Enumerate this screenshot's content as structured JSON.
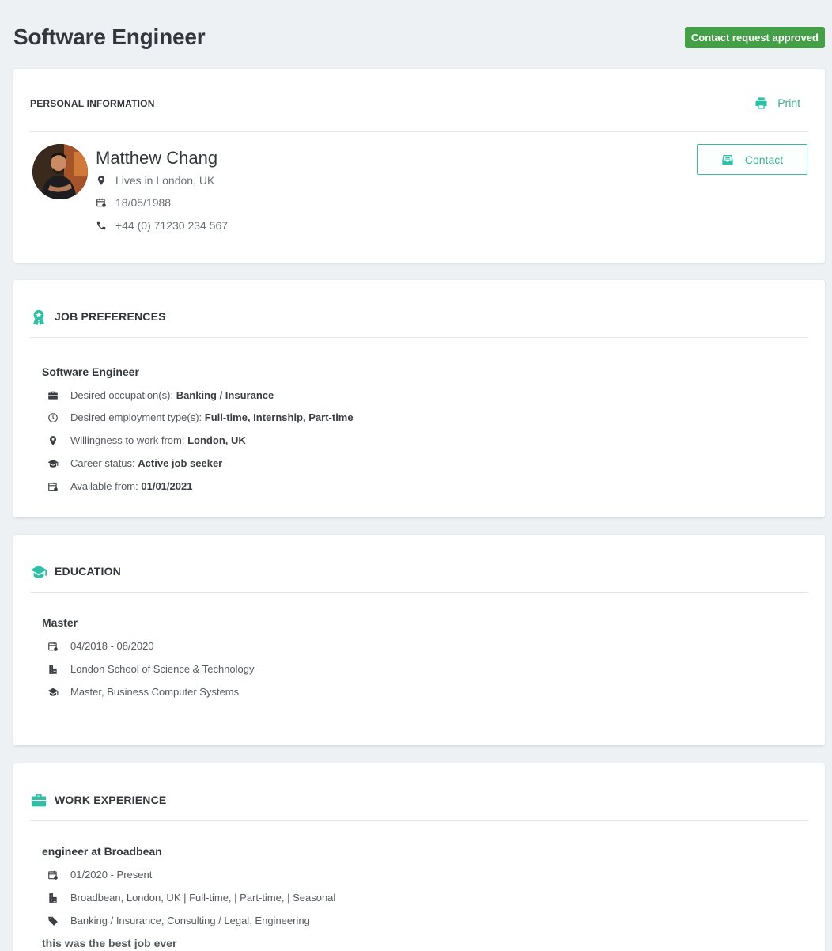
{
  "header": {
    "title": "Software Engineer",
    "status_badge": "Contact request approved",
    "status_color": "#43a047"
  },
  "personal": {
    "section_title": "Personal Information",
    "print_label": "Print",
    "name": "Matthew Chang",
    "location": "Lives in London, UK",
    "birthdate": "18/05/1988",
    "phone": "+44 (0) 71230 234 567",
    "contact_label": "Contact"
  },
  "job_preferences": {
    "section_title": "Job Preferences",
    "job_title": "Software Engineer",
    "rows": [
      {
        "label": "Desired occupation(s): ",
        "value": "Banking / Insurance",
        "icon": "briefcase-icon"
      },
      {
        "label": "Desired employment type(s): ",
        "value": "Full-time, Internship, Part-time",
        "icon": "clock-icon"
      },
      {
        "label": "Willingness to work from: ",
        "value": "London, UK",
        "icon": "location-pin-icon"
      },
      {
        "label": "Career status: ",
        "value": "Active job seeker",
        "icon": "graduation-cap-icon"
      },
      {
        "label": "Available from: ",
        "value": "01/01/2021",
        "icon": "calendar-icon"
      }
    ]
  },
  "education": {
    "section_title": "Education",
    "degree": "Master",
    "rows": [
      {
        "text": "04/2018 - 08/2020",
        "icon": "calendar-icon"
      },
      {
        "text": "London School of Science & Technology",
        "icon": "building-icon"
      },
      {
        "text": "Master, Business Computer Systems",
        "icon": "graduation-cap-icon"
      }
    ]
  },
  "work_experience": {
    "section_title": "Work Experience",
    "position": "engineer at Broadbean",
    "rows": [
      {
        "text": "01/2020 - Present",
        "icon": "calendar-icon"
      },
      {
        "text": "Broadbean, London, UK | Full-time,  | Part-time,  | Seasonal",
        "icon": "building-icon"
      },
      {
        "text": "Banking / Insurance, Consulting / Legal, Engineering",
        "icon": "tag-icon"
      }
    ],
    "description": "this was the best job ever"
  },
  "colors": {
    "accent": "#2ebfa5",
    "accent_text": "#3fae94",
    "page_bg": "#eef1f4"
  }
}
